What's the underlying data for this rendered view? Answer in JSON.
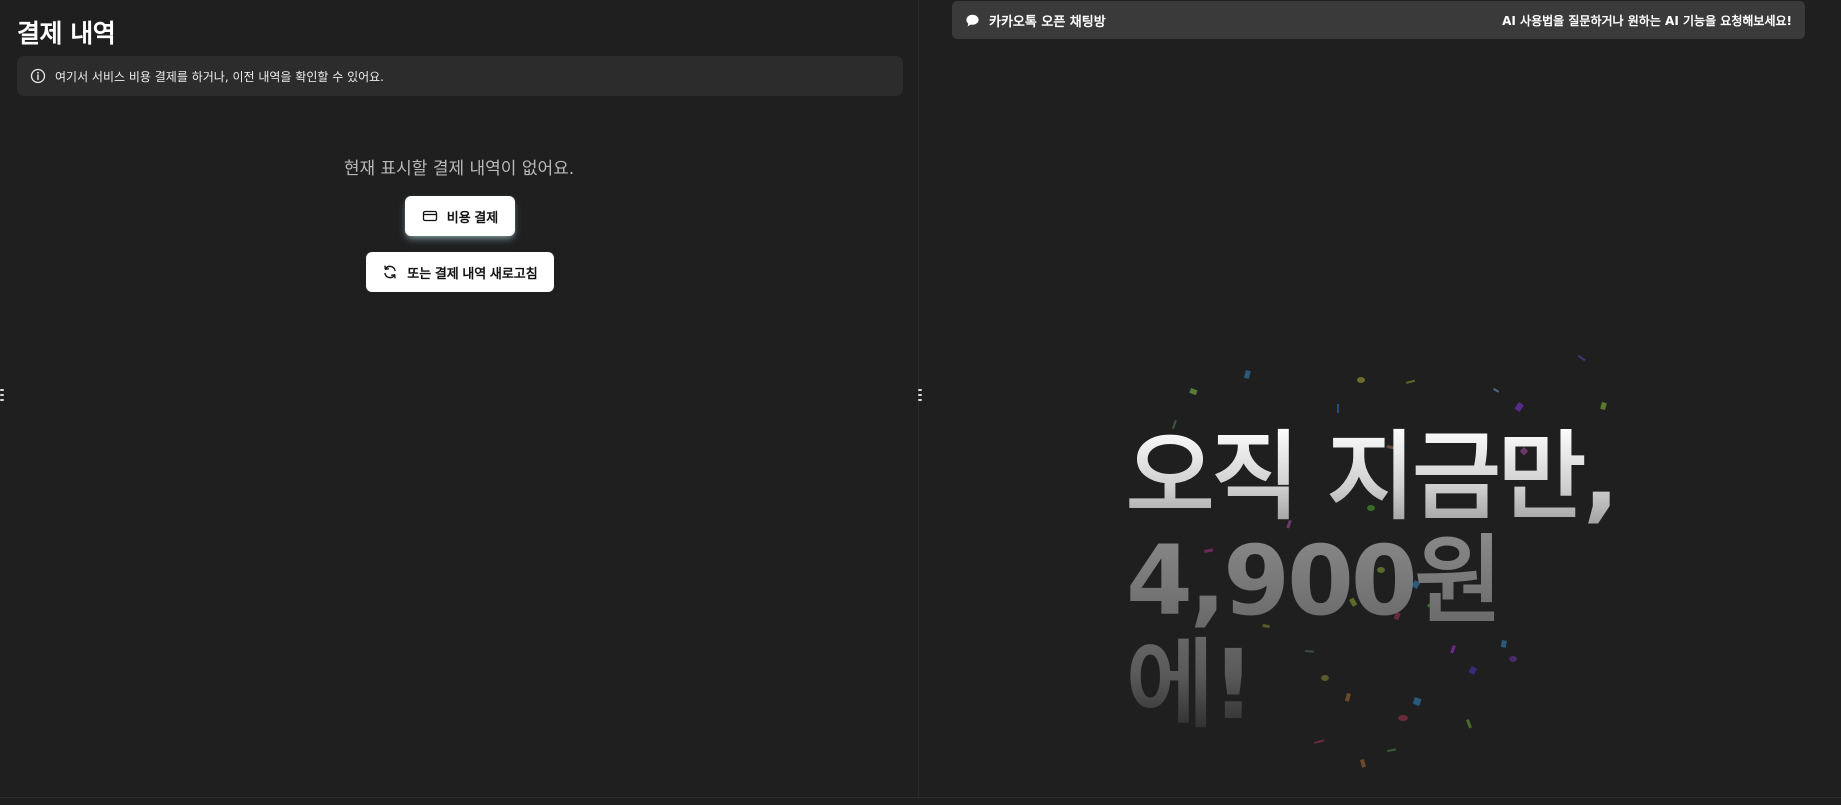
{
  "left": {
    "title": "결제 내역",
    "info_text": "여기서 서비스 비용 결제를 하거나, 이전 내역을 확인할 수 있어요.",
    "empty_message": "현재 표시할 결제 내역이 없어요.",
    "pay_button_label": "비용 결제",
    "refresh_button_label": "또는 결제 내역 새로고침"
  },
  "right": {
    "kakao_label": "카카오톡 오픈 채팅방",
    "kakao_cta": "AI 사용법을 질문하거나 원하는 AI 기능을 요청해보세요!",
    "promo_line1": "오직 지금만,",
    "promo_line2": "4,900원에!"
  },
  "icons": {
    "info": "info-icon",
    "chat": "chat-bubble-icon",
    "card": "credit-card-icon",
    "refresh": "refresh-icon",
    "drag": "drag-handle-icon"
  },
  "colors": {
    "background": "#1f1f1f",
    "info_bar": "#2c2c2c",
    "kakao_bar": "#3a3a3a",
    "button": "#ffffff"
  }
}
